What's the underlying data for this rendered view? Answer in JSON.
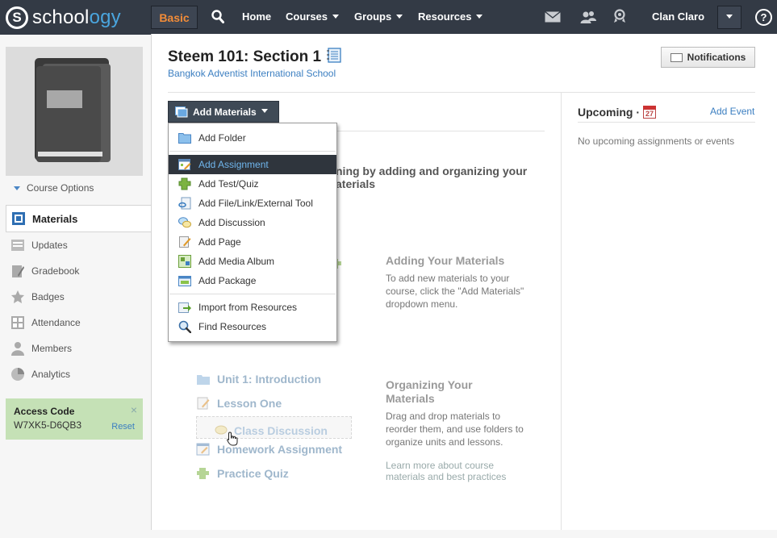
{
  "topbar": {
    "logo_letter": "S",
    "logo_text_main": "school",
    "logo_text_accent": "ogy",
    "basic_label": "Basic",
    "nav": {
      "home": "Home",
      "courses": "Courses",
      "groups": "Groups",
      "resources": "Resources"
    },
    "user_name": "Clan Claro",
    "help_label": "?"
  },
  "sidebar": {
    "course_options": "Course Options",
    "items": [
      {
        "label": "Materials",
        "icon": "materials-icon",
        "active": true
      },
      {
        "label": "Updates",
        "icon": "updates-icon"
      },
      {
        "label": "Gradebook",
        "icon": "gradebook-icon"
      },
      {
        "label": "Badges",
        "icon": "badges-icon"
      },
      {
        "label": "Attendance",
        "icon": "attendance-icon"
      },
      {
        "label": "Members",
        "icon": "members-icon"
      },
      {
        "label": "Analytics",
        "icon": "analytics-icon"
      }
    ],
    "access_code": {
      "title": "Access Code",
      "value": "W7XK5-D6QB3",
      "reset": "Reset",
      "close": "×"
    }
  },
  "header": {
    "title": "Steem 101: Section 1",
    "school": "Bangkok Adventist International School",
    "notifications": "Notifications"
  },
  "materials": {
    "add_button": "Add Materials",
    "menu": [
      {
        "label": "Add Folder",
        "icon": "folder-icon"
      },
      {
        "label": "Add Assignment",
        "icon": "assignment-icon",
        "highlighted": true
      },
      {
        "label": "Add Test/Quiz",
        "icon": "quiz-icon"
      },
      {
        "label": "Add File/Link/External Tool",
        "icon": "file-link-icon"
      },
      {
        "label": "Add Discussion",
        "icon": "discussion-icon"
      },
      {
        "label": "Add Page",
        "icon": "page-icon"
      },
      {
        "label": "Add Media Album",
        "icon": "media-album-icon"
      },
      {
        "label": "Add Package",
        "icon": "package-icon"
      },
      {
        "label": "Import from Resources",
        "icon": "import-icon"
      },
      {
        "label": "Find Resources",
        "icon": "find-icon"
      }
    ],
    "bg_heading_line1": "ning by adding and organizing your",
    "bg_heading_line2": "aterials",
    "adding_title": "Adding Your Materials",
    "adding_text": "To add new materials to your course, click the \"Add Materials\" dropdown menu.",
    "organizing_title": "Organizing Your Materials",
    "organizing_text": "Drag and drop materials to reorder them, and use folders to organize units and lessons.",
    "learn_more": "Learn more about course materials and best practices",
    "ghost_items": {
      "unit": "Unit 1: Introduction",
      "lesson": "Lesson One",
      "discussion": "Class Discussion",
      "homework": "Homework Assignment",
      "quiz": "Practice Quiz"
    }
  },
  "upcoming": {
    "title": "Upcoming ·",
    "calendar_day": "27",
    "add_event": "Add Event",
    "empty": "No upcoming assignments or events"
  },
  "colors": {
    "topbar": "#333a45",
    "accent_orange": "#f28c38",
    "link_blue": "#3c7fc1",
    "access_code_bg": "#c5e1b6",
    "menu_highlight": "#2f353d"
  }
}
